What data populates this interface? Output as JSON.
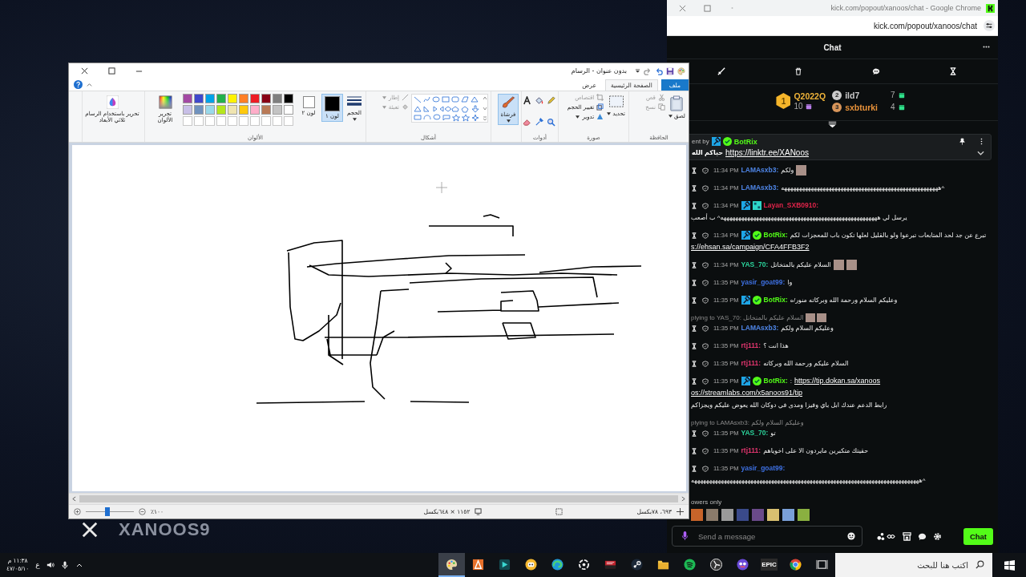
{
  "desktop": {
    "wallpaper_text": "XANOOS9"
  },
  "browser": {
    "title": "kick.com/popout/xanoos/chat - Google Chrome",
    "url": "kick.com/popout/xanoos/chat"
  },
  "chat": {
    "title": "Chat",
    "leaderboard": {
      "top": {
        "rank": "1",
        "name": "Q2022Q",
        "count": "10",
        "color": "#f0b43a"
      },
      "runners_up": [
        {
          "rank": "2",
          "name": "ild7",
          "count": "7",
          "color": "#c9c9c9"
        },
        {
          "rank": "3",
          "name": "sxbturki",
          "count": "4",
          "color": "#e8923a"
        }
      ]
    },
    "pinned": {
      "prefix": "ent by",
      "badges": [
        {
          "kind": "mod"
        },
        {
          "kind": "verified"
        }
      ],
      "user": "BotRix",
      "text": "حياكم الله",
      "link": "https://linktr.ee/XANoos"
    },
    "messages": [
      {
        "time": "11:34 PM",
        "user": "LAMAsxb3:",
        "color": "#4f86e8",
        "parts": [
          {
            "kind": "text",
            "text": "ولكم"
          },
          {
            "kind": "emote"
          }
        ]
      },
      {
        "time": "11:34 PM",
        "user": "LAMAsxb3:",
        "color": "#4f86e8",
        "parts": [
          {
            "kind": "text",
            "text": "هههههههههههههههههههههههههههههههههههههههههههههههههههههه^"
          }
        ]
      },
      {
        "time": "11:34 PM",
        "badges": [
          {
            "kind": "mod"
          },
          {
            "kind": "og"
          }
        ],
        "user": "Layan_SXB0910:",
        "color": "#e0244a",
        "parts": [
          {
            "kind": "text",
            "text": "يرسل لي هههههههههههههههههههههههههههههههههههههههههههههههههههههه^ ب أصعب"
          }
        ]
      },
      {
        "time": "11:34 PM",
        "badges": [
          {
            "kind": "mod"
          },
          {
            "kind": "verified"
          }
        ],
        "user": "BotRix:",
        "color": "#53fc18",
        "parts": [
          {
            "kind": "text",
            "text": "تبرع عن جد لحد المتابعات تبرعوا ولو بالقليل لعلها تكون باب للمعجزات لكم"
          },
          {
            "kind": "link",
            "text": "s://ehsan.sa/campaign/CFA4FFB3F2"
          }
        ]
      },
      {
        "time": "11:34 PM",
        "user": "YAS_70:",
        "color": "#2bd39b",
        "parts": [
          {
            "kind": "text",
            "text": "السلام عليكم بالمتخاتل"
          },
          {
            "kind": "emote"
          },
          {
            "kind": "emote"
          }
        ]
      },
      {
        "time": "11:35 PM",
        "user": "yasir_goat99:",
        "color": "#3d6fe0",
        "parts": [
          {
            "kind": "text",
            "text": "وا"
          }
        ]
      },
      {
        "time": "11:35 PM",
        "badges": [
          {
            "kind": "mod"
          },
          {
            "kind": "verified"
          }
        ],
        "user": "BotRix:",
        "color": "#53fc18",
        "parts": [
          {
            "kind": "text",
            "text": "وعليكم السلام ورحمة الله وبركاته منور/ه"
          }
        ]
      },
      {
        "time": "11:35 PM",
        "user": "LAMAsxb3:",
        "color": "#4f86e8",
        "reply": {
          "text": "plying to YAS_70: السلام عليكم بالمتخاتل",
          "emotes": [
            {
              "kind": "emote"
            },
            {
              "kind": "emote"
            }
          ]
        },
        "parts": [
          {
            "kind": "text",
            "text": "وعليكم السلام ولكم"
          }
        ]
      },
      {
        "time": "11:35 PM",
        "user": "rtj111:",
        "color": "#e0356e",
        "parts": [
          {
            "kind": "text",
            "text": "هذا انت ؟"
          }
        ]
      },
      {
        "time": "11:35 PM",
        "user": "rtj111:",
        "color": "#e0356e",
        "parts": [
          {
            "kind": "text",
            "text": "السلام عليكم ورحمة الله وبركاته"
          }
        ]
      },
      {
        "time": "11:35 PM",
        "badges": [
          {
            "kind": "mod"
          },
          {
            "kind": "verified"
          }
        ],
        "user": "BotRix:",
        "color": "#53fc18",
        "parts": [
          {
            "kind": "text",
            "text": ":"
          },
          {
            "kind": "link",
            "text": "https://tip.dokan.sa/xanoos"
          },
          {
            "kind": "link",
            "text": "os://streamlabs.com/x5anoos91/tip"
          },
          {
            "kind": "text",
            "text": "رابط الدعم عندك ابل باي وفيزا ومدى في دوكان الله يعوض عليكم ويجزاكم"
          }
        ]
      },
      {
        "time": "11:35 PM",
        "user": "YAS_70:",
        "color": "#2bd39b",
        "reply": {
          "text": "plying to LAMAsxb3: وعليكم السلام ولكم"
        },
        "parts": [
          {
            "kind": "text",
            "text": "تو"
          }
        ]
      },
      {
        "time": "11:35 PM",
        "user": "rtj111:",
        "color": "#e0356e",
        "parts": [
          {
            "kind": "text",
            "text": "حقيتك متكبرين مايردون الا على اخوياهم"
          }
        ]
      },
      {
        "time": "11:35 PM",
        "user": "yasir_goat99:",
        "color": "#3d6fe0",
        "parts": [
          {
            "kind": "text",
            "text": "هههههههههههههههههههههههههههههههههههههههههههههههههههههههههههههههههههههههههههههه^"
          }
        ]
      }
    ],
    "followers_label": "owers only",
    "input": {
      "placeholder": "Send a message"
    },
    "send_button": "Chat"
  },
  "paint": {
    "title": "بدون عنوان - الرسام",
    "tabs": [
      {
        "label": "ملف",
        "kind": "file",
        "selected": false
      },
      {
        "label": "الصفحة الرئيسية",
        "kind": "tab",
        "selected": true
      },
      {
        "label": "عرض",
        "kind": "tab",
        "selected": false
      }
    ],
    "clipboard": {
      "label": "الحافظة",
      "paste": {
        "label": "لصق",
        "disabled": false
      },
      "cut": {
        "label": "قص",
        "disabled": true
      },
      "copy": {
        "label": "نسخ",
        "disabled": true
      }
    },
    "image": {
      "label": "صورة",
      "select": {
        "label": "تحديد",
        "disabled": false
      },
      "crop": {
        "label": "اقتصاص",
        "disabled": true
      },
      "resize": {
        "label": "تغيير الحجم",
        "disabled": false
      },
      "rotate": {
        "label": "تدوير",
        "disabled": false
      }
    },
    "tools": {
      "label": "أدوات"
    },
    "brushes": {
      "label": "فرشاة"
    },
    "shapes": {
      "label": "أشكال",
      "outline": {
        "label": "إطار",
        "disabled": true
      },
      "fill": {
        "label": "تعبئة",
        "disabled": true
      }
    },
    "colors": {
      "label": "الألوان",
      "size": "الحجم",
      "slots": [
        {
          "label": "لون ١",
          "color": "#000000",
          "selected": true
        },
        {
          "label": "لون ٢",
          "color": "#ffffff",
          "selected": false
        }
      ],
      "palette": [
        {
          "color": "#000000"
        },
        {
          "color": "#7f7f7f"
        },
        {
          "color": "#880015"
        },
        {
          "color": "#ed1c24"
        },
        {
          "color": "#ff7f27"
        },
        {
          "color": "#fff200"
        },
        {
          "color": "#22b14c"
        },
        {
          "color": "#00a2e8"
        },
        {
          "color": "#3f48cc"
        },
        {
          "color": "#a349a4"
        },
        {
          "color": "#ffffff"
        },
        {
          "color": "#c3c3c3"
        },
        {
          "color": "#b97a57"
        },
        {
          "color": "#ffaec9"
        },
        {
          "color": "#ffc90e"
        },
        {
          "color": "#efe4b0"
        },
        {
          "color": "#b5e61d"
        },
        {
          "color": "#99d9ea"
        },
        {
          "color": "#7092be"
        },
        {
          "color": "#c8bfe7"
        }
      ],
      "edit": "تحرير الألوان"
    },
    "paint3d": "تحرير باستخدام الرسام ثلاثي الأبعاد",
    "status": {
      "cursor": "٦٩٣، ٧٨بكسل",
      "image_size": "١١٥٢ × ٦٤٨بكسل",
      "zoom": {
        "reading": "١٠٠٪",
        "level": 0.45
      }
    }
  },
  "taskbar": {
    "search": {
      "placeholder": "اكتب هنا للبحث"
    },
    "apps": [
      {
        "kind": "taskview",
        "selected": false
      },
      {
        "kind": "ring",
        "selected": false
      },
      {
        "kind": "label",
        "label": "EPIC",
        "selected": false
      },
      {
        "kind": "face",
        "selected": false
      },
      {
        "kind": "dial",
        "selected": false
      },
      {
        "kind": "waves",
        "selected": false
      },
      {
        "kind": "folder",
        "selected": false
      },
      {
        "kind": "steam",
        "selected": false
      },
      {
        "kind": "mixer",
        "selected": false
      },
      {
        "kind": "target",
        "selected": false
      },
      {
        "kind": "swirl",
        "selected": false
      },
      {
        "kind": "bubble",
        "selected": false
      },
      {
        "kind": "play",
        "selected": false
      },
      {
        "kind": "cone",
        "selected": false
      },
      {
        "kind": "paint",
        "selected": true
      }
    ],
    "tray": {
      "language": "ع",
      "time": "١١:٣٨ م",
      "date": "٤٧/٠٥/١٠"
    }
  }
}
